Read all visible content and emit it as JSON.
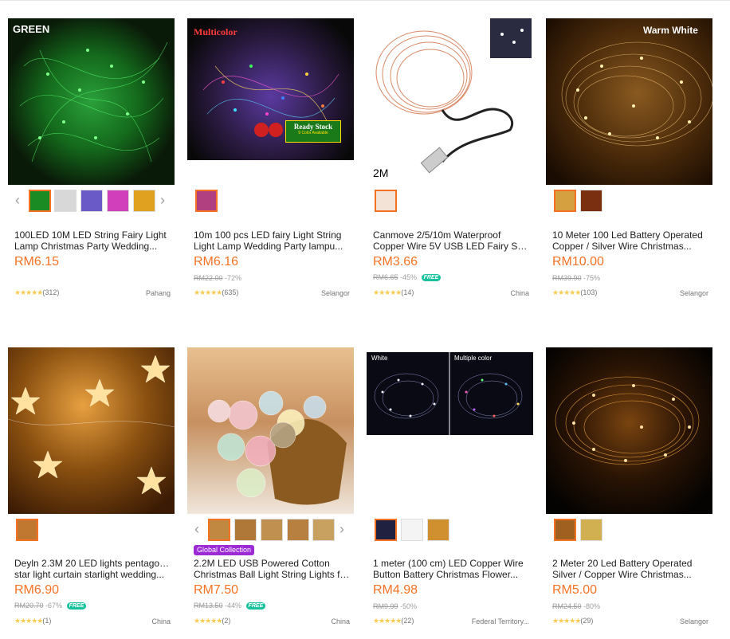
{
  "products": [
    {
      "title_line1": "100LED 10M LED String Fairy Light",
      "title_line2": "Lamp Christmas Party Wedding...",
      "price": "RM6.15",
      "original_price": "",
      "discount": "",
      "free_shipping": false,
      "rating_count": "(312)",
      "location": "Pahang",
      "image_label": "GREEN",
      "colors": {
        "bg": "#0a1a08",
        "glow": "#22cc33"
      },
      "thumbs": [
        "#1a8a22",
        "#e8e8e8",
        "#6a5ac8",
        "#d23fbb",
        "#e0a020"
      ]
    },
    {
      "title_line1": "10m 100 pcs LED fairy Light String",
      "title_line2": "Light Lamp Wedding Party lampu...",
      "price": "RM6.16",
      "original_price": "RM22.00",
      "discount": "-72%",
      "free_shipping": false,
      "rating_count": "(635)",
      "location": "Selangor",
      "image_label": "Multicolor",
      "image_label2": "Ready Stock",
      "image_label3": "9 Color Available",
      "colors": {
        "bg": "#111",
        "glow": "#cc33ff"
      },
      "thumbs": [
        "#b04080"
      ]
    },
    {
      "title_line1": "Canmove 2/5/10m Waterproof",
      "title_line2": "Copper Wire 5V USB LED Fairy Strin...",
      "price": "RM3.66",
      "original_price": "RM6.65",
      "discount": "-45%",
      "free_shipping": true,
      "rating_count": "(14)",
      "location": "China",
      "image_label": "2M",
      "colors": {
        "bg": "#ffffff",
        "glow": "#d98a66"
      },
      "thumbs": [
        "#e8d0c0"
      ]
    },
    {
      "title_line1": "10 Meter 100 Led Battery Operated",
      "title_line2": "Copper / Silver Wire Christmas...",
      "price": "RM10.00",
      "original_price": "RM39.90",
      "discount": "-75%",
      "free_shipping": false,
      "rating_count": "(103)",
      "location": "Selangor",
      "image_label": "Warm White",
      "colors": {
        "bg": "#3a2208",
        "glow": "#ffcc66"
      },
      "thumbs": [
        "#d4a040",
        "#7a3010"
      ]
    },
    {
      "title_line1": "Deyln 2.3M 20 LED lights pentagonal",
      "title_line2": "star light curtain starlight wedding...",
      "price": "RM6.90",
      "original_price": "RM20.70",
      "discount": "-67%",
      "free_shipping": true,
      "rating_count": "(1)",
      "location": "China",
      "colors": {
        "bg": "#6a3a10",
        "glow": "#ffd98a"
      },
      "thumbs": [
        "#c07830"
      ]
    },
    {
      "title_line1": "2.2M LED USB Powered Cotton",
      "title_line2": "Christmas Ball Light String Lights fo...",
      "price": "RM7.50",
      "original_price": "RM13.50",
      "discount": "-44%",
      "free_shipping": true,
      "rating_count": "(2)",
      "location": "China",
      "global_collection": "Global Collection",
      "colors": {
        "bg": "#c9a27a",
        "glow": "#f2c0cc"
      },
      "thumbs": [
        "#c08840",
        "#b07838",
        "#c09050",
        "#b88040",
        "#c8a060"
      ]
    },
    {
      "title_line1": "1 meter (100 cm) LED Copper Wire",
      "title_line2": "Button Battery Christmas Flower...",
      "price": "RM4.98",
      "original_price": "RM9.99",
      "discount": "-50%",
      "free_shipping": false,
      "rating_count": "(22)",
      "location": "Federal Territory...",
      "image_label": "White",
      "image_label2": "Multiple color",
      "colors": {
        "bg": "#0a0a14",
        "glow": "#c8d0ff"
      },
      "thumbs": [
        "#202040",
        "#f4f4f4",
        "#d09030"
      ]
    },
    {
      "title_line1": "2 Meter 20 Led Battery Operated",
      "title_line2": "Silver / Copper Wire Christmas...",
      "price": "RM5.00",
      "original_price": "RM24.50",
      "discount": "-80%",
      "free_shipping": false,
      "rating_count": "(29)",
      "location": "Selangor",
      "colors": {
        "bg": "#0a0604",
        "glow": "#ffb040"
      },
      "thumbs": [
        "#a06020",
        "#d0b050"
      ]
    }
  ],
  "free_label": "FREE",
  "stars": "★★★★★"
}
